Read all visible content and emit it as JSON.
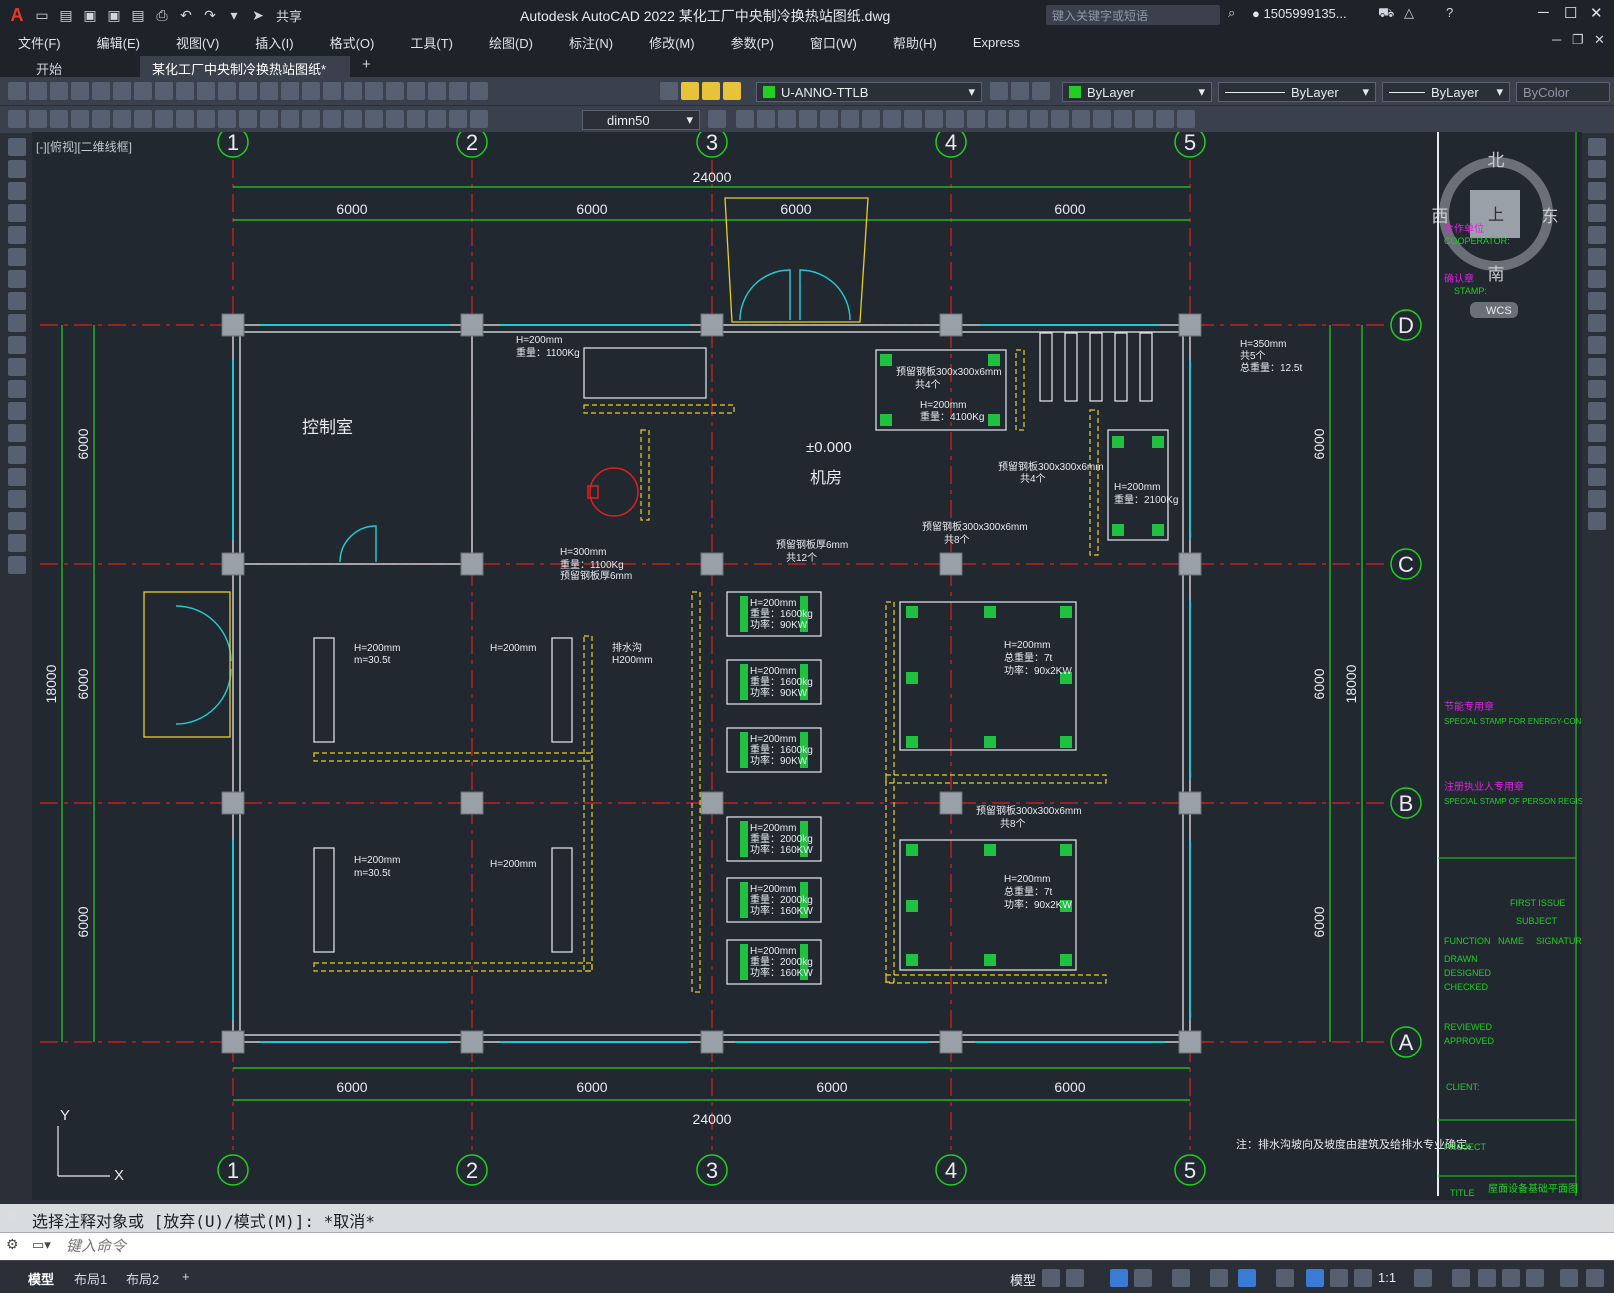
{
  "app": {
    "title": "Autodesk AutoCAD 2022    某化工厂中央制冷换热站图纸.dwg",
    "share_label": "共享",
    "search_placeholder": "键入关键字或短语",
    "user": "1505999135..."
  },
  "menu": [
    "文件(F)",
    "编辑(E)",
    "视图(V)",
    "插入(I)",
    "格式(O)",
    "工具(T)",
    "绘图(D)",
    "标注(N)",
    "修改(M)",
    "参数(P)",
    "窗口(W)",
    "帮助(H)",
    "Express"
  ],
  "tabs": {
    "start": "开始",
    "file": "某化工厂中央制冷换热站图纸*",
    "close": "✕"
  },
  "toolbar": {
    "layer": "U-ANNO-TTLB",
    "color": "ByLayer",
    "linetype": "ByLayer",
    "lineweight": "ByLayer",
    "plotstyle": "ByColor",
    "dimstyle": "dimn50"
  },
  "view_label": "[-][俯视][二维线框]",
  "viewcube": {
    "north": "北",
    "south": "南",
    "east": "东",
    "west": "西",
    "top": "上",
    "wcs": "WCS"
  },
  "drawing": {
    "grid_top": [
      "1",
      "2",
      "3",
      "4",
      "5"
    ],
    "grid_right": [
      "D",
      "C",
      "B",
      "A"
    ],
    "dim_total": "24000",
    "dim_bay": "6000",
    "dim_total_vertical": "18000",
    "room_control": "控制室",
    "room_machine": "机房",
    "level": "±0.000",
    "note": "注：排水沟坡向及坡度由建筑及给排水专业确定。",
    "labels": {
      "tank1": "H=200mm",
      "tank1_w": "重量：1100Kg",
      "pump": "H=300mm",
      "pump_w": "重量：1100Kg",
      "pump_plate": "预留钢板厚6mm",
      "eq_hx": "H=200mm",
      "eq_hx_w": "重量：4100Kg",
      "plate_300": "预留钢板300x300x6mm",
      "qty4": "共4个",
      "qty8": "共8个",
      "qty12": "共12个",
      "qty5": "共5个",
      "h350": "H=350mm",
      "total125": "总重量：12.5t",
      "eq_r": "H=200mm",
      "eq_r_w": "重量：2100Kg",
      "chiller": "H=200mm",
      "chiller_w": "m=30.5t",
      "drain": "排水沟",
      "drain_h": "H200mm",
      "p1": "H=200mm",
      "p1_w": "重量：1600kg",
      "p1_p": "功率：90KW",
      "p2": "H=200mm",
      "p2_w": "重量：2000kg",
      "p2_p": "功率：160KW",
      "tower": "H=200mm",
      "tower_w": "总重量：7t",
      "tower_p": "功率：90x2KW",
      "plate_6": "预留钢板厚6mm"
    }
  },
  "titleblock": {
    "cooperator": "合作单位",
    "cooperator_en": "COOPERATOR:",
    "stamp": "确认章",
    "stamp_en": "STAMP:",
    "energy": "节能专用章",
    "energy_en": "SPECIAL STAMP FOR ENERGY-CONSERVATION:",
    "registered": "注册执业人专用章",
    "registered_en": "SPECIAL STAMP OF PERSON REGISTERED:",
    "issue": "FIRST ISSUE",
    "subject": "SUBJECT",
    "function": "FUNCTION",
    "name": "NAME",
    "signature": "SIGNATUR",
    "drawn": "DRAWN",
    "designed": "DESIGNED",
    "checked": "CHECKED",
    "reviewed": "REVIEWED",
    "approved": "APPROVED",
    "client": "CLIENT:",
    "project": "PROJECT",
    "title": "TITLE",
    "title_cn": "屋面设备基础平面图"
  },
  "command": {
    "history": "选择注释对象或 [放弃(U)/模式(M)]: *取消*",
    "placeholder": "键入命令"
  },
  "status": {
    "layouts": [
      "模型",
      "布局1",
      "布局2"
    ],
    "model": "模型",
    "scale": "1:1"
  }
}
